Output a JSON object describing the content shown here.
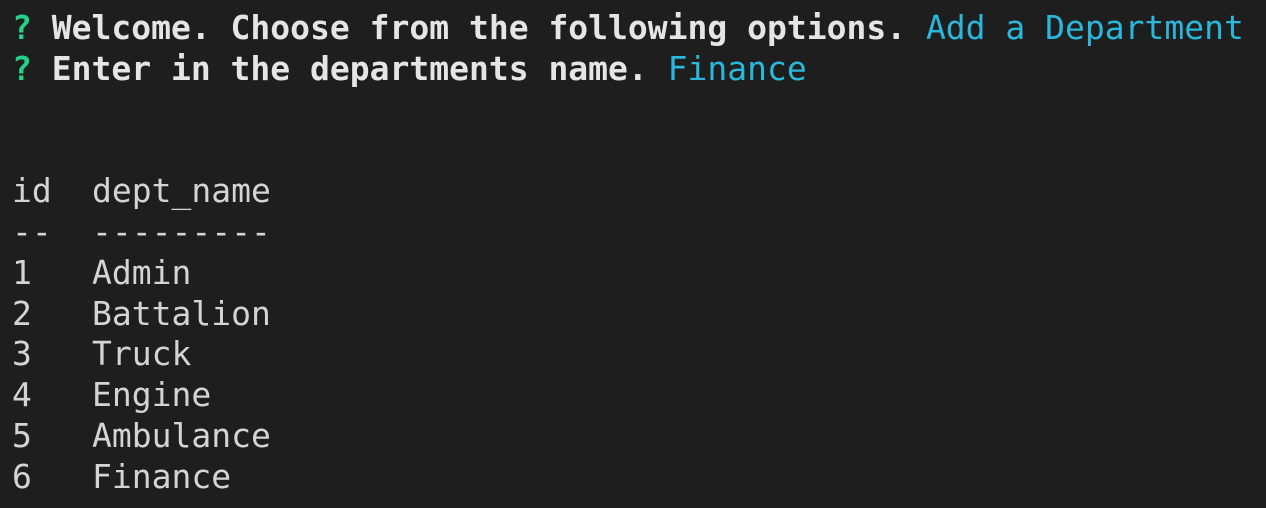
{
  "colors": {
    "background": "#1e1e1e",
    "foreground": "#d4d4d4",
    "prompt_marker": "#23d18b",
    "answer": "#29b8db"
  },
  "prompts": [
    {
      "marker": "?",
      "question": "Welcome. Choose from the following options.",
      "answer": "Add a Department"
    },
    {
      "marker": "?",
      "question": "Enter in the departments name.",
      "answer": "Finance"
    }
  ],
  "table": {
    "headers": [
      "id",
      "dept_name"
    ],
    "separators": [
      "--",
      "---------"
    ],
    "rows": [
      [
        "1",
        "Admin"
      ],
      [
        "2",
        "Battalion"
      ],
      [
        "3",
        "Truck"
      ],
      [
        "4",
        "Engine"
      ],
      [
        "5",
        "Ambulance"
      ],
      [
        "6",
        "Finance"
      ]
    ]
  }
}
